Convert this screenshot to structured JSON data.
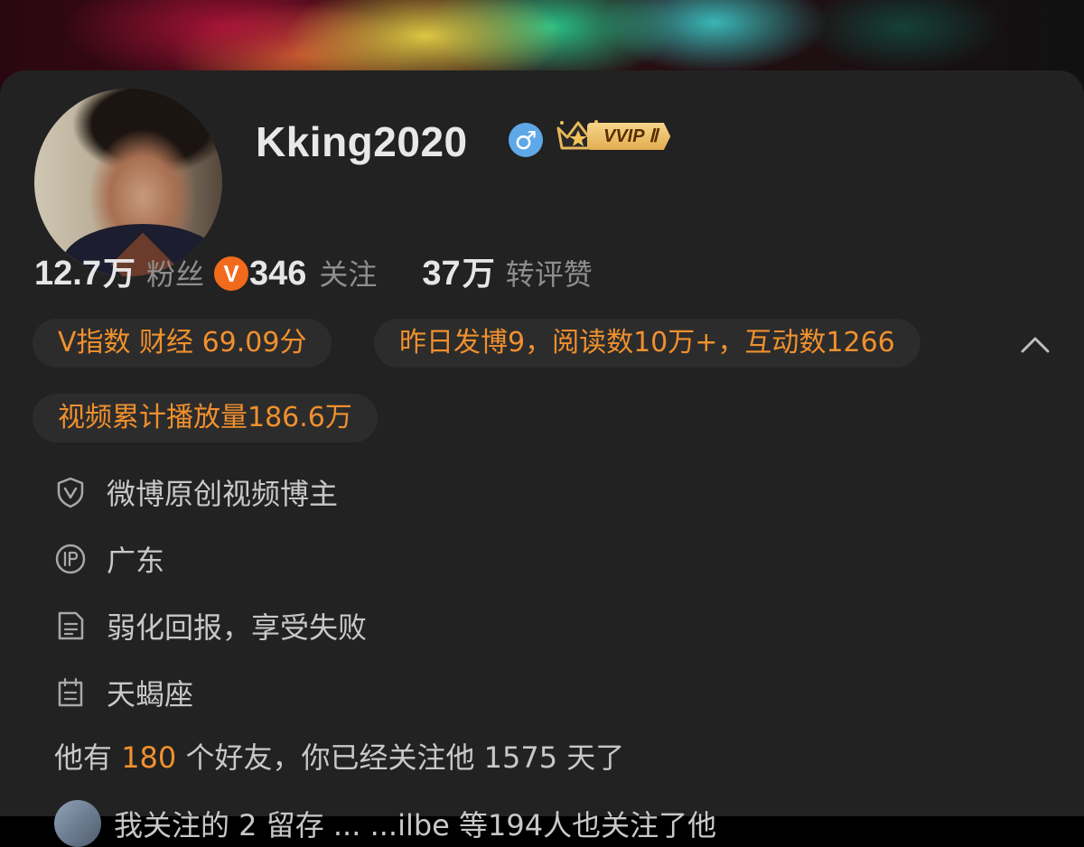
{
  "profile": {
    "username": "Kking2020",
    "gender_symbol": "♂",
    "verified_badge": "V",
    "vip_label": "VVIP",
    "vip_level": "Ⅱ"
  },
  "stats": [
    {
      "num": "12.7",
      "unit": "万",
      "label": "粉丝"
    },
    {
      "num": "346",
      "unit": "",
      "label": "关注"
    },
    {
      "num": "37",
      "unit": "万",
      "label": "转评赞"
    }
  ],
  "pills": {
    "v_index": "V指数 财经 69.09分",
    "yesterday": "昨日发博9，阅读数10万+，互动数1266",
    "video_plays": "视频累计播放量186.6万"
  },
  "info": [
    {
      "icon": "shield-v-icon",
      "text": "微博原创视频博主"
    },
    {
      "icon": "ip-icon",
      "text": "广东"
    },
    {
      "icon": "document-icon",
      "text": "弱化回报，享受失败"
    },
    {
      "icon": "calendar-icon",
      "text": "天蝎座"
    }
  ],
  "friends": {
    "prefix": "他有",
    "count": "180",
    "suffix": "个好友，你已经关注他 1575 天了"
  },
  "bottom_partial_text": "我关注的 2 留存 ... ...ilbe 等194人也关注了他",
  "colors": {
    "accent": "#f0902e",
    "card_bg": "#222222",
    "pill_bg": "#2c2c2c",
    "verified": "#f26a1b",
    "gender": "#5fa8e8"
  }
}
